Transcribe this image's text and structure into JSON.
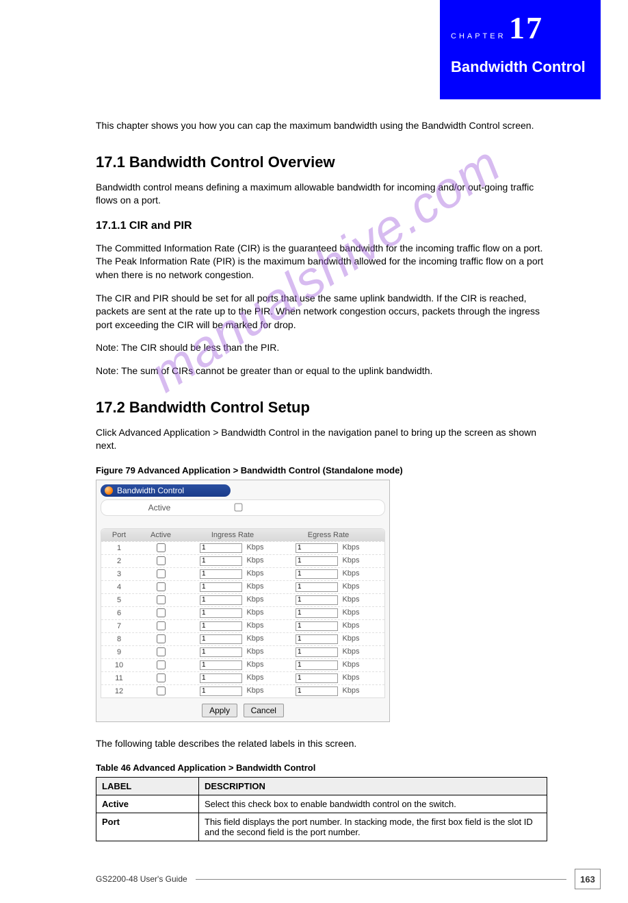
{
  "header": {
    "chapter_number": "17",
    "chapter_title": "Bandwidth Control"
  },
  "intro": "This chapter shows you how you can cap the maximum bandwidth using the Bandwidth Control screen.",
  "section": {
    "num_title": "17.1  Bandwidth Control Overview",
    "p1": "Bandwidth control means defining a maximum allowable bandwidth for incoming and/or out-going traffic flows on a port.",
    "sub_title": "17.1.1  CIR and PIR",
    "p2": "The Committed Information Rate (CIR) is the guaranteed bandwidth for the incoming traffic flow on a port. The Peak Information Rate (PIR) is the maximum bandwidth allowed for the incoming traffic flow on a port when there is no network congestion.",
    "p3": "The CIR and PIR should be set for all ports that use the same uplink bandwidth. If the CIR is reached, packets are sent at the rate up to the PIR. When network congestion occurs, packets through the ingress port exceeding the CIR will be marked for drop.",
    "note": "Note: The CIR should be less than the PIR.",
    "note2": "Note: The sum of CIRs cannot be greater than or equal to the uplink bandwidth."
  },
  "section2": {
    "title": "17.2  Bandwidth Control Setup",
    "lead": "Click Advanced Application > Bandwidth Control in the navigation panel to bring up the screen as shown next."
  },
  "figure": {
    "caption": "Figure 79   Advanced Application > Bandwidth Control (Standalone mode)",
    "panel_title": "Bandwidth Control",
    "active_label": "Active",
    "columns": {
      "port": "Port",
      "active": "Active",
      "ingress": "Ingress Rate",
      "egress": "Egress Rate"
    },
    "unit": "Kbps",
    "rows": [
      {
        "port": "1",
        "ingress": "1",
        "egress": "1"
      },
      {
        "port": "2",
        "ingress": "1",
        "egress": "1"
      },
      {
        "port": "3",
        "ingress": "1",
        "egress": "1"
      },
      {
        "port": "4",
        "ingress": "1",
        "egress": "1"
      },
      {
        "port": "5",
        "ingress": "1",
        "egress": "1"
      },
      {
        "port": "6",
        "ingress": "1",
        "egress": "1"
      },
      {
        "port": "7",
        "ingress": "1",
        "egress": "1"
      },
      {
        "port": "8",
        "ingress": "1",
        "egress": "1"
      },
      {
        "port": "9",
        "ingress": "1",
        "egress": "1"
      },
      {
        "port": "10",
        "ingress": "1",
        "egress": "1"
      },
      {
        "port": "11",
        "ingress": "1",
        "egress": "1"
      },
      {
        "port": "12",
        "ingress": "1",
        "egress": "1"
      }
    ],
    "apply": "Apply",
    "cancel": "Cancel"
  },
  "table": {
    "caption": "The following table describes the related labels in this screen.",
    "title": "Table 46   Advanced Application > Bandwidth Control",
    "head": {
      "label": "LABEL",
      "desc": "DESCRIPTION"
    },
    "rows": [
      {
        "label": "Active",
        "desc": "Select this check box to enable bandwidth control on the switch."
      },
      {
        "label": "Port",
        "desc": "This field displays the port number. In stacking mode, the first box field is the slot ID and the second field is the port number."
      }
    ]
  },
  "footer": {
    "guide": "GS2200-48 User's Guide",
    "page": "163"
  },
  "watermark": "manualshive.com"
}
